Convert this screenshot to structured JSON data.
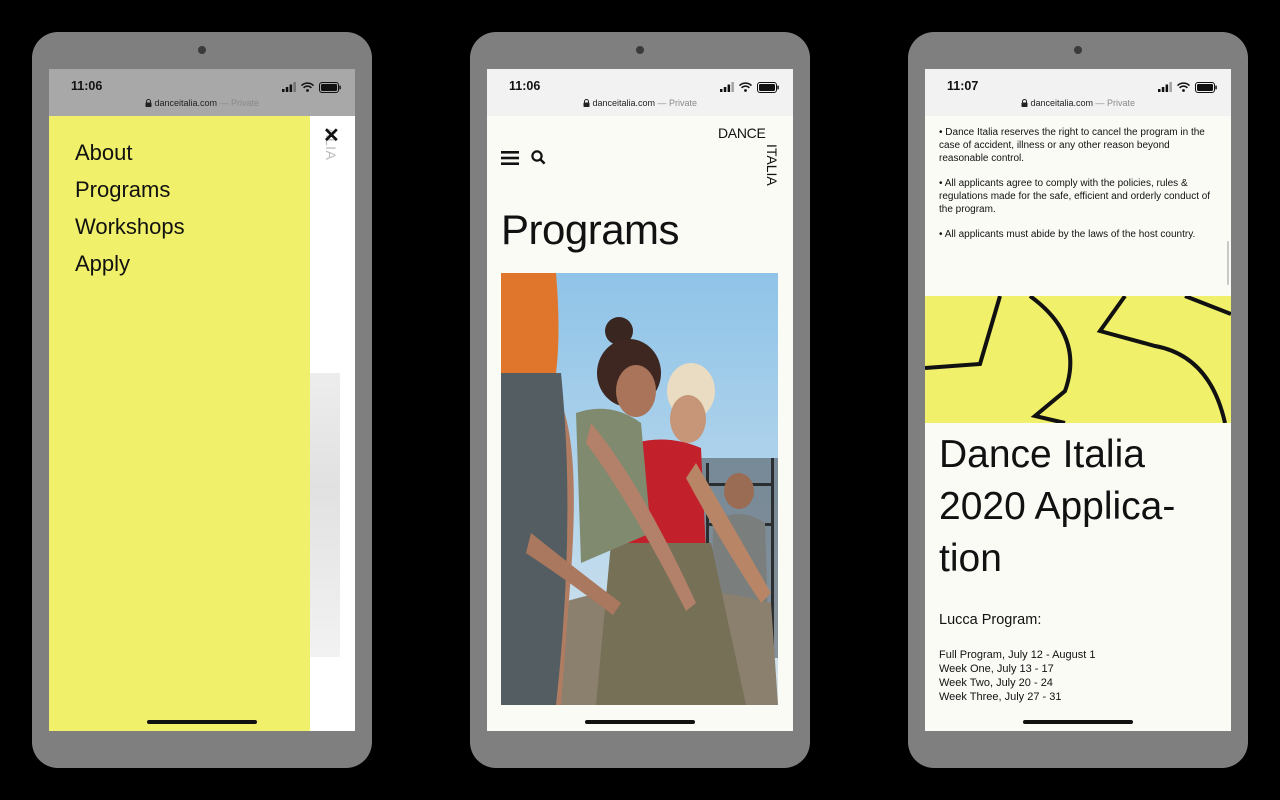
{
  "colors": {
    "accent_yellow": "#f0f06a",
    "ink": "#111111",
    "device": "#7f7f7f",
    "background": "#000000"
  },
  "screens": [
    {
      "status": {
        "time": "11:06",
        "url": "danceitalia.com",
        "private": "— Private"
      },
      "menu": {
        "items": [
          "About",
          "Programs",
          "Workshops",
          "Apply"
        ],
        "close_icon": "close-icon",
        "close_glyph": "✕"
      },
      "behind_logo_fragment": "ALIA"
    },
    {
      "status": {
        "time": "11:06",
        "url": "danceitalia.com",
        "private": "— Private"
      },
      "header": {
        "menu_icon": "hamburger-icon",
        "search_icon": "search-icon",
        "logo_top": "DANCE",
        "logo_vertical": "ITALIA"
      },
      "title": "Programs",
      "image": "dancers-photo"
    },
    {
      "status": {
        "time": "11:07",
        "url": "danceitalia.com",
        "private": "— Private"
      },
      "bullets": [
        "• Dance Italia reserves the right to cancel the program in the case of accident, illness or any other reason beyond reasonable control.",
        "• All applicants agree to comply with the policies, rules & regulations made for the safe, efficient and orderly conduct of the program.",
        "• All applicants must abide by the laws of the host country."
      ],
      "title": "Dance Italia 2020 Applica­tion",
      "program_heading": "Lucca Program:",
      "weeks": [
        "Full Program, July 12 - August 1",
        "Week One, July 13 - 17",
        "Week Two, July 20 - 24",
        "Week Three, July 27 - 31"
      ]
    }
  ]
}
